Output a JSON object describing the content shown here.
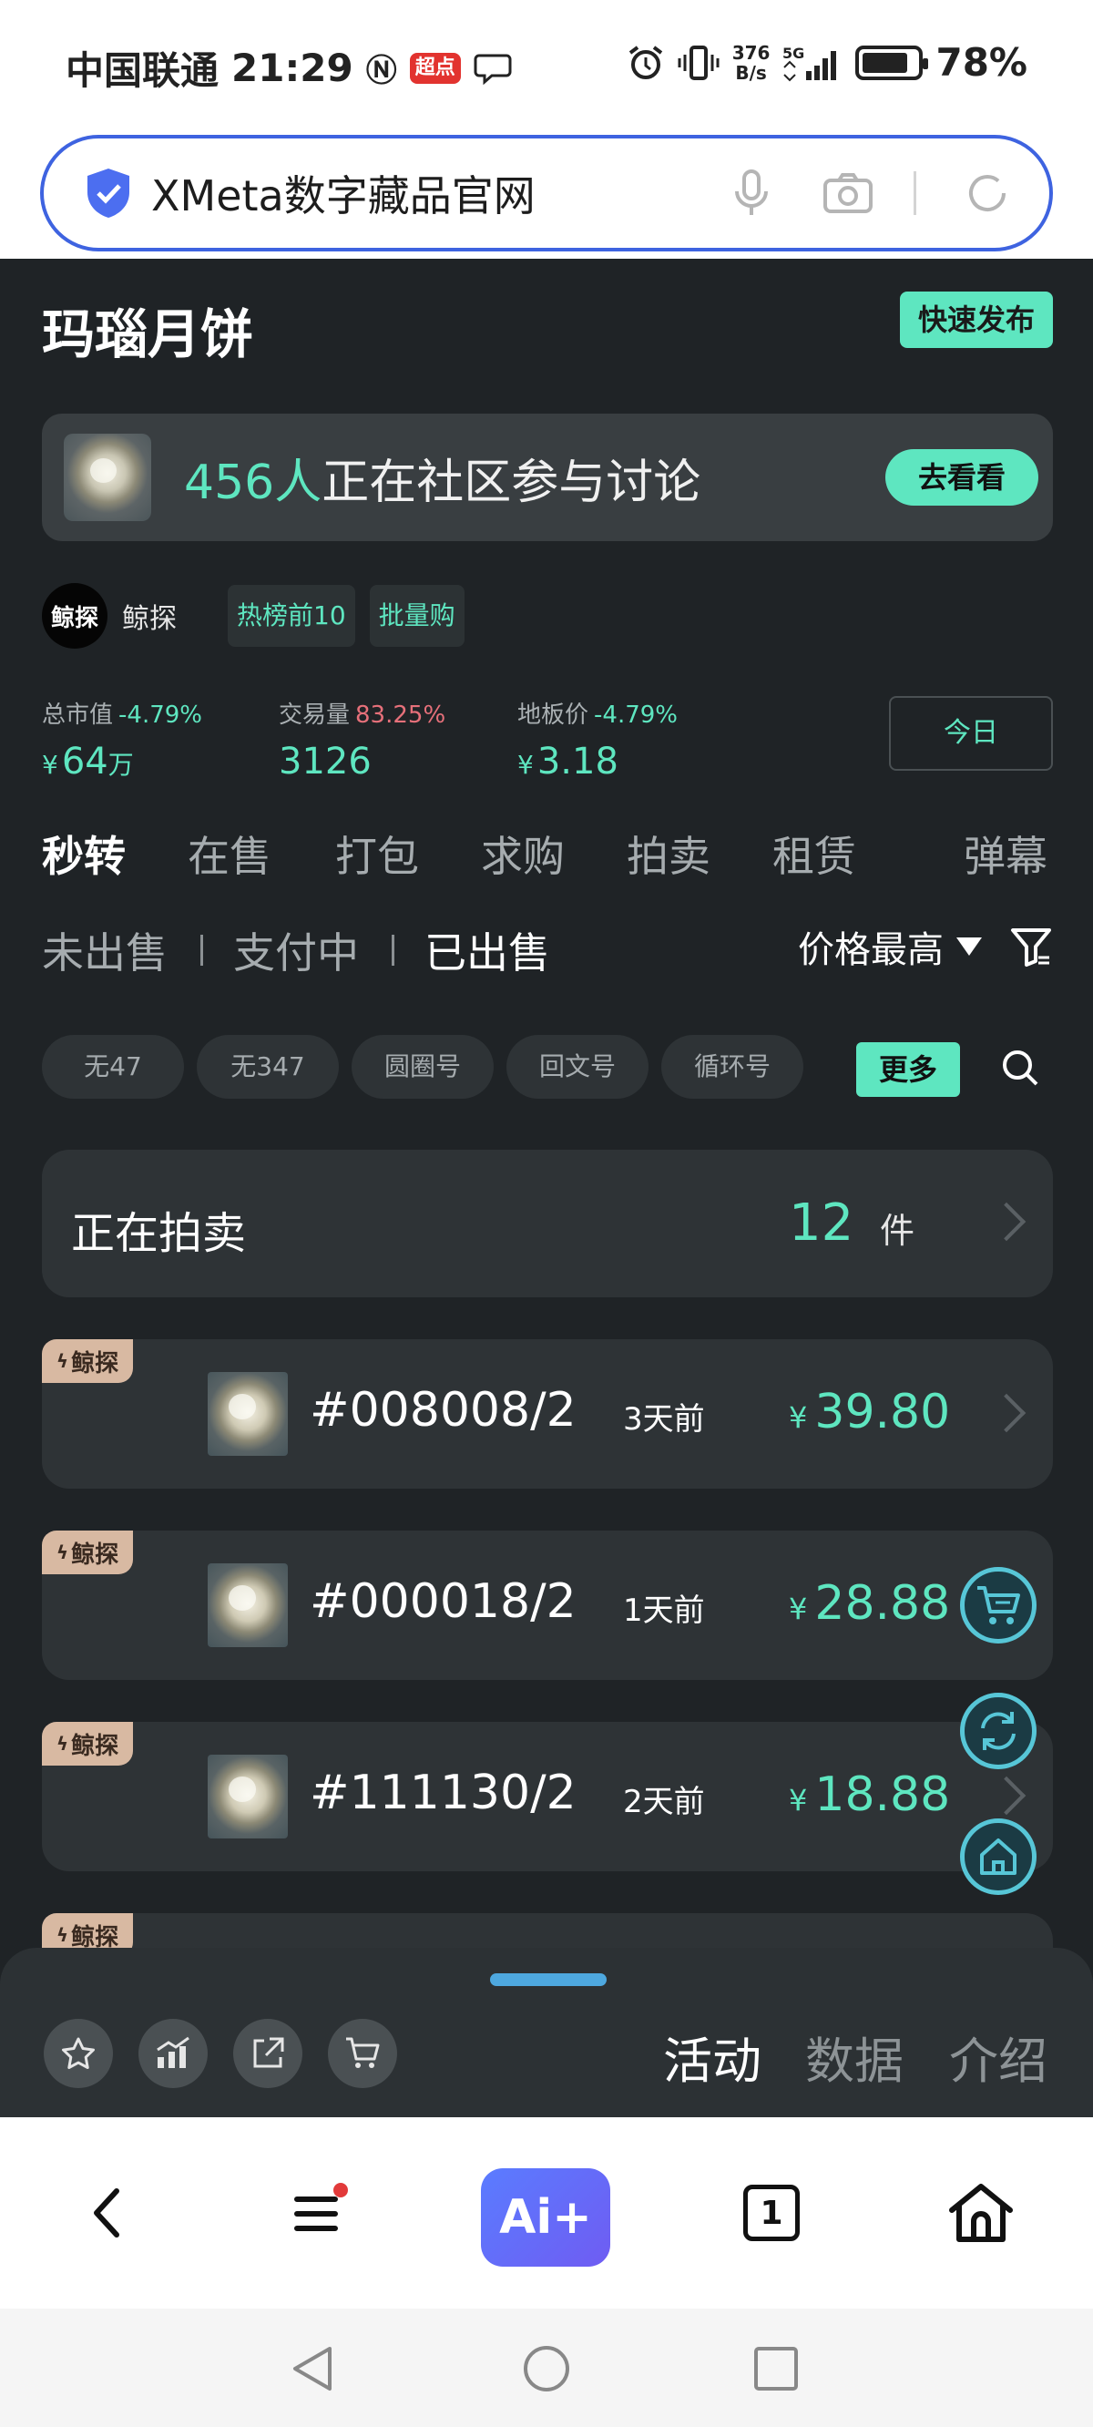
{
  "status_bar": {
    "carrier": "中国联通",
    "time": "21:29",
    "app_badge": "超点",
    "net_speed_value": "376",
    "net_speed_unit": "B/s",
    "network": "5G",
    "battery": "78%"
  },
  "url_bar": {
    "text": "XMeta数字藏品官网"
  },
  "page": {
    "title": "玛瑙月饼",
    "quick_publish": "快速发布",
    "community": {
      "count": "456人",
      "text": "正在社区参与讨论",
      "button": "去看看"
    },
    "brand": {
      "logo_text": "鲸探",
      "name": "鲸探",
      "tags": [
        "热榜前10",
        "批量购"
      ]
    },
    "stats": [
      {
        "label": "总市值",
        "change": "-4.79%",
        "currency": "¥",
        "value": "64",
        "unit": "万"
      },
      {
        "label": "交易量",
        "change": "83.25%",
        "currency": "",
        "value": "3126",
        "unit": ""
      },
      {
        "label": "地板价",
        "change": "-4.79%",
        "currency": "¥",
        "value": "3.18",
        "unit": ""
      }
    ],
    "today_button": "今日",
    "tabs": [
      "秒转",
      "在售",
      "打包",
      "求购",
      "拍卖",
      "租赁",
      "弹幕"
    ],
    "subtabs": [
      "未出售",
      "支付中",
      "已出售"
    ],
    "sort_label": "价格最高",
    "chips": [
      "无47",
      "无347",
      "圆圈号",
      "回文号",
      "循环号"
    ],
    "more_button": "更多",
    "auction": {
      "label": "正在拍卖",
      "count": "12",
      "unit": "件"
    },
    "items": [
      {
        "badge": "鲸探",
        "code": "#008008/2",
        "ago": "3天前",
        "currency": "¥",
        "price": "39.80"
      },
      {
        "badge": "鲸探",
        "code": "#000018/2",
        "ago": "1天前",
        "currency": "¥",
        "price": "28.88"
      },
      {
        "badge": "鲸探",
        "code": "#111130/2",
        "ago": "2天前",
        "currency": "¥",
        "price": "18.88"
      },
      {
        "badge": "鲸探"
      }
    ]
  },
  "drawer": {
    "tabs": [
      "活动",
      "数据",
      "介绍"
    ],
    "icons": [
      "star-icon",
      "trend-icon",
      "share-icon",
      "cart-icon"
    ]
  },
  "browser_nav": {
    "ai_label": "Ai+",
    "tab_count": "1"
  },
  "colors": {
    "accent": "#5ee6c0",
    "background": "#1f2326",
    "card": "#2e3336",
    "up_red": "#e6707a",
    "url_border": "#3e63e0"
  }
}
